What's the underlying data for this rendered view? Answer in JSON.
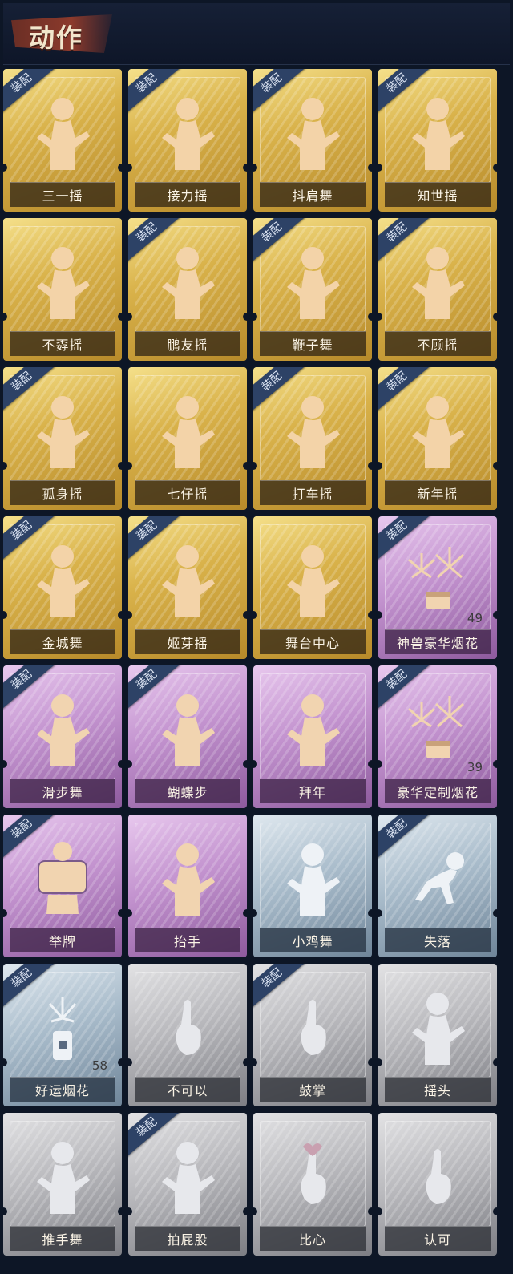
{
  "header": {
    "title": "动作"
  },
  "equip_badge_text": "装配",
  "colors": {
    "gold": "#d9b24a",
    "purple": "#c393cf",
    "blue": "#a9bccb",
    "grey": "#b9b9bd",
    "badge": "#2d4266",
    "background": "#0d1626"
  },
  "actions": [
    {
      "name": "三一摇",
      "rarity": "gold",
      "equipped": true,
      "icon": "shrug-pose-icon"
    },
    {
      "name": "接力摇",
      "rarity": "gold",
      "equipped": true,
      "icon": "hands-on-hips-pose-icon"
    },
    {
      "name": "抖肩舞",
      "rarity": "gold",
      "equipped": true,
      "icon": "shoulder-dance-pose-icon"
    },
    {
      "name": "知世摇",
      "rarity": "gold",
      "equipped": true,
      "icon": "arms-out-pose-icon"
    },
    {
      "name": "不孬摇",
      "rarity": "gold",
      "equipped": false,
      "icon": "arm-raised-pose-icon"
    },
    {
      "name": "鹏友摇",
      "rarity": "gold",
      "equipped": true,
      "icon": "pointing-pose-icon"
    },
    {
      "name": "鞭子舞",
      "rarity": "gold",
      "equipped": true,
      "icon": "heart-dance-pose-icon"
    },
    {
      "name": "不顾摇",
      "rarity": "gold",
      "equipped": true,
      "icon": "pointing-up-pose-icon"
    },
    {
      "name": "孤身摇",
      "rarity": "gold",
      "equipped": true,
      "icon": "star-dance-pose-icon"
    },
    {
      "name": "七仔摇",
      "rarity": "gold",
      "equipped": false,
      "icon": "crossed-arms-pose-icon"
    },
    {
      "name": "打车摇",
      "rarity": "gold",
      "equipped": true,
      "icon": "music-note-pose-icon"
    },
    {
      "name": "新年摇",
      "rarity": "gold",
      "equipped": true,
      "icon": "clasped-hands-pose-icon"
    },
    {
      "name": "金城舞",
      "rarity": "gold",
      "equipped": true,
      "icon": "wave-pose-icon"
    },
    {
      "name": "姬芽摇",
      "rarity": "gold",
      "equipped": true,
      "icon": "sway-pose-icon"
    },
    {
      "name": "舞台中心",
      "rarity": "gold",
      "equipped": false,
      "icon": "center-stage-pose-icon"
    },
    {
      "name": "神兽豪华烟花",
      "rarity": "purple",
      "equipped": true,
      "icon": "fireworks-icon",
      "count": "49"
    },
    {
      "name": "滑步舞",
      "rarity": "purple",
      "equipped": true,
      "icon": "slide-dance-pose-icon"
    },
    {
      "name": "蝴蝶步",
      "rarity": "purple",
      "equipped": true,
      "icon": "butterfly-step-pose-icon"
    },
    {
      "name": "拜年",
      "rarity": "purple",
      "equipped": false,
      "icon": "new-year-greeting-pose-icon"
    },
    {
      "name": "豪华定制烟花",
      "rarity": "purple",
      "equipped": true,
      "icon": "fireworks-box-icon",
      "count": "39"
    },
    {
      "name": "举牌",
      "rarity": "purple",
      "equipped": true,
      "icon": "sign-holding-icon"
    },
    {
      "name": "抬手",
      "rarity": "purple",
      "equipped": false,
      "icon": "raise-hand-pose-icon"
    },
    {
      "name": "小鸡舞",
      "rarity": "blue",
      "equipped": false,
      "icon": "chicken-dance-pose-icon"
    },
    {
      "name": "失落",
      "rarity": "blue",
      "equipped": true,
      "icon": "crawling-pose-icon"
    },
    {
      "name": "好运烟花",
      "rarity": "blue",
      "equipped": true,
      "icon": "firecracker-icon",
      "count": "58"
    },
    {
      "name": "不可以",
      "rarity": "grey",
      "equipped": false,
      "icon": "finger-wag-icon"
    },
    {
      "name": "鼓掌",
      "rarity": "grey",
      "equipped": true,
      "icon": "clapping-hands-icon"
    },
    {
      "name": "摇头",
      "rarity": "grey",
      "equipped": false,
      "icon": "head-shake-pose-icon"
    },
    {
      "name": "推手舞",
      "rarity": "grey",
      "equipped": false,
      "icon": "push-hands-pose-icon"
    },
    {
      "name": "拍屁股",
      "rarity": "grey",
      "equipped": true,
      "icon": "butt-slap-pose-icon"
    },
    {
      "name": "比心",
      "rarity": "grey",
      "equipped": false,
      "icon": "finger-heart-icon"
    },
    {
      "name": "认可",
      "rarity": "grey",
      "equipped": false,
      "icon": "thumbs-up-icon"
    }
  ]
}
